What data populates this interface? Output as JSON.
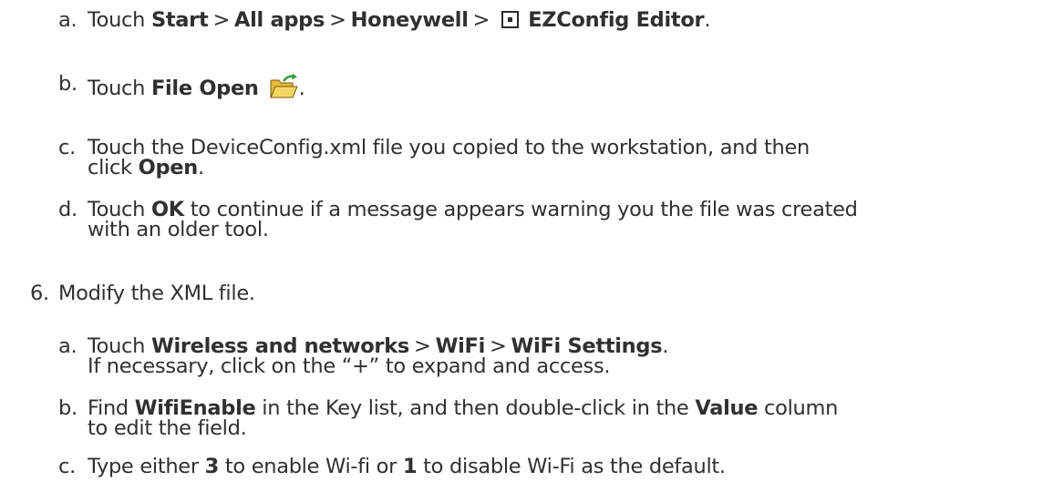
{
  "steps": {
    "a1": {
      "label": "a.",
      "t1": "Touch ",
      "b1": "Start",
      "sep1": ">",
      "b2": "All apps",
      "sep2": ">",
      "b3": "Honeywell",
      "sep3": ">",
      "icon": "ezconfig-app-icon",
      "b4": "EZConfig Editor",
      "end": "."
    },
    "b1": {
      "label": "b.",
      "t1": "Touch ",
      "b1": "File Open",
      "icon": "open-folder-icon",
      "end": "."
    },
    "c1": {
      "label": "c.",
      "line1": "Touch the DeviceConfig.xml file you copied to the workstation, and then",
      "t2": "click ",
      "b1": "Open",
      "end": "."
    },
    "d1": {
      "label": "d.",
      "t1": "Touch ",
      "b1": "OK",
      "t2": " to continue if a message appears warning you the file was created",
      "line2": "with an older tool."
    },
    "s6": {
      "label": "6.",
      "text": "Modify the XML file."
    },
    "a2": {
      "label": "a.",
      "t1": "Touch ",
      "b1": "Wireless and networks",
      "sep1": ">",
      "b2": "WiFi",
      "sep2": ">",
      "b3": "WiFi Settings",
      "end": ".",
      "line2": "If necessary, click on the “+” to expand and access."
    },
    "b2": {
      "label": "b.",
      "t1": "Find ",
      "b1": "WifiEnable",
      "t2": " in the Key list, and then double-click in the ",
      "b2": "Value",
      "t3": " column",
      "line2": "to edit the field."
    },
    "c2": {
      "label": "c.",
      "t1": "Type either ",
      "b1": "3",
      "t2": " to enable Wi-fi or ",
      "b2": "1",
      "t3": " to disable Wi-Fi as the default."
    }
  },
  "colors": {
    "text": "#303030",
    "folder_yellow": "#f2c94c",
    "arrow_green": "#3f9b3c"
  }
}
